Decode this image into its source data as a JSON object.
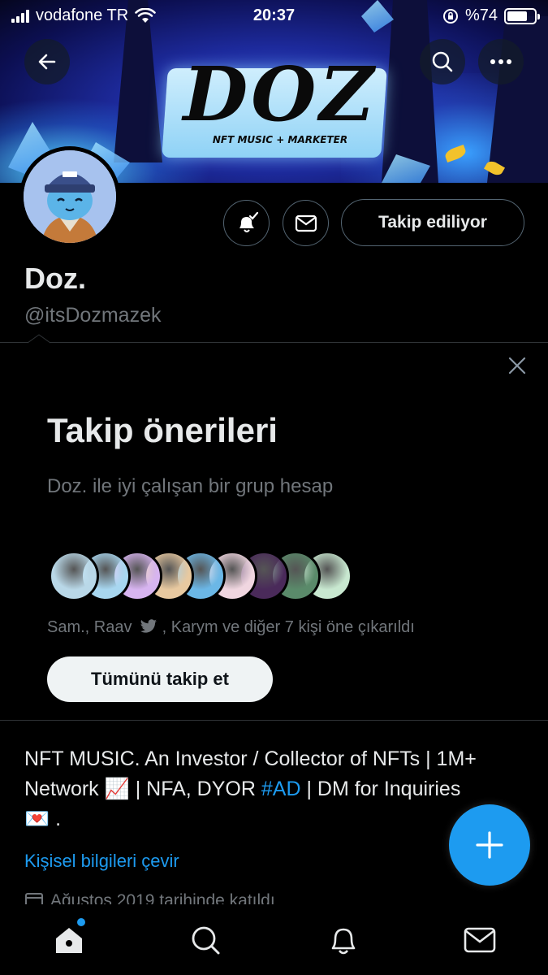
{
  "status_bar": {
    "carrier": "vodafone TR",
    "time": "20:37",
    "battery": "%74",
    "battery_level": 0.74
  },
  "banner": {
    "logo_text": "DOZ",
    "logo_subtitle": "NFT MUSIC + MARKETER"
  },
  "profile": {
    "name": "Doz.",
    "handle": "@itsDozmazek",
    "following_label": "Takip ediliyor"
  },
  "suggestions": {
    "title": "Takip önerileri",
    "subtitle": "Doz. ile iyi çalışan bir grup hesap",
    "highlight_prefix": "Sam., Raav",
    "highlight_suffix": ", Karym ve diğer 7 kişi öne çıkarıldı",
    "follow_all_label": "Tümünü takip et",
    "avatar_colors": [
      "#b9d8e8",
      "#a8d7f0",
      "#d7b4f0",
      "#e8c9a0",
      "#6bb7e6",
      "#f0d6e0",
      "#4a2a5a",
      "#5a8a6a",
      "#c8e8d0"
    ]
  },
  "bio": {
    "line1": "NFT MUSIC. An Investor / Collector of NFTs | 1M+",
    "line2_a": "Network ",
    "chart_emoji": "📈",
    "line2_b": " | NFA, DYOR ",
    "hashtag": "#AD",
    "line2_c": " | DM for Inquiries",
    "heart_emoji": "💌",
    "line3_end": " ."
  },
  "translate_label": "Kişisel bilgileri çevir",
  "joined_text": "Ağustos 2019 tarihinde katıldı",
  "colors": {
    "accent": "#1d9bf0",
    "background": "#000000",
    "text_primary": "#e7e9ea",
    "text_secondary": "#71767b"
  },
  "icons": [
    "back-arrow-icon",
    "search-icon",
    "more-icon",
    "bell-icon",
    "mail-icon",
    "close-icon",
    "plus-icon",
    "home-icon",
    "search-tab-icon",
    "notifications-icon",
    "messages-icon",
    "calendar-icon"
  ]
}
